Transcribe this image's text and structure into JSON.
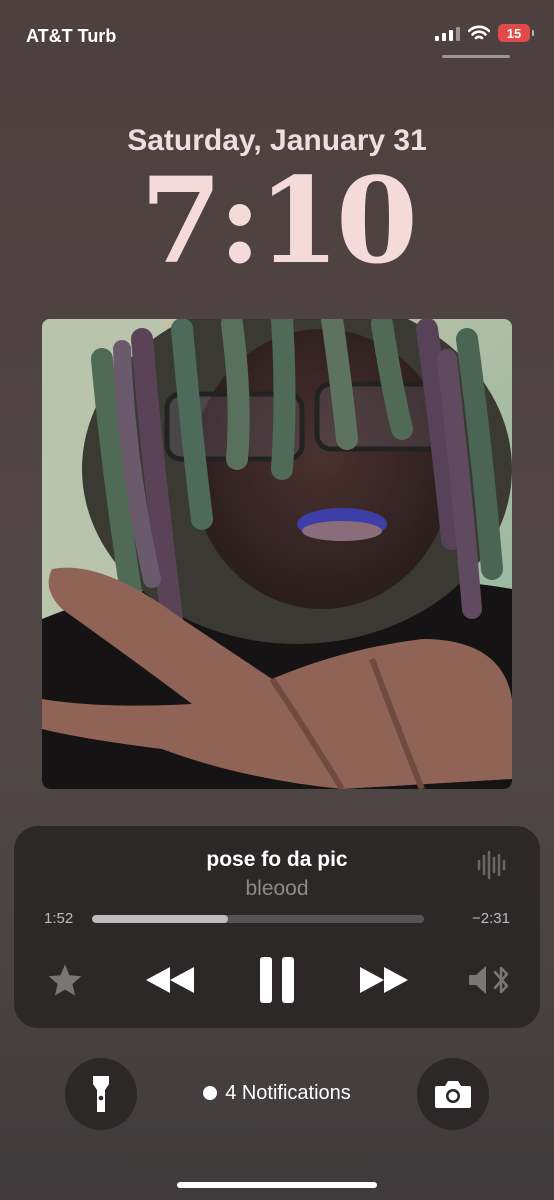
{
  "status_bar": {
    "carrier": "AT&T Turb",
    "battery_level": "15",
    "signal_icon": "signal-icon",
    "wifi_icon": "wifi-icon"
  },
  "lock_screen": {
    "date": "Saturday, January 31",
    "time": "7:10"
  },
  "now_playing": {
    "title": "pose fo da pic",
    "artist": "bleood",
    "elapsed": "1:52",
    "remaining": "−2:31",
    "progress": 0.41,
    "controls": [
      "star-icon",
      "rewind-icon",
      "pause-icon",
      "fast-forward-icon",
      "speaker-bluetooth-icon"
    ]
  },
  "bottom": {
    "notifications_label": "4 Notifications",
    "flashlight_icon": "flashlight-icon",
    "camera_icon": "camera-icon"
  }
}
